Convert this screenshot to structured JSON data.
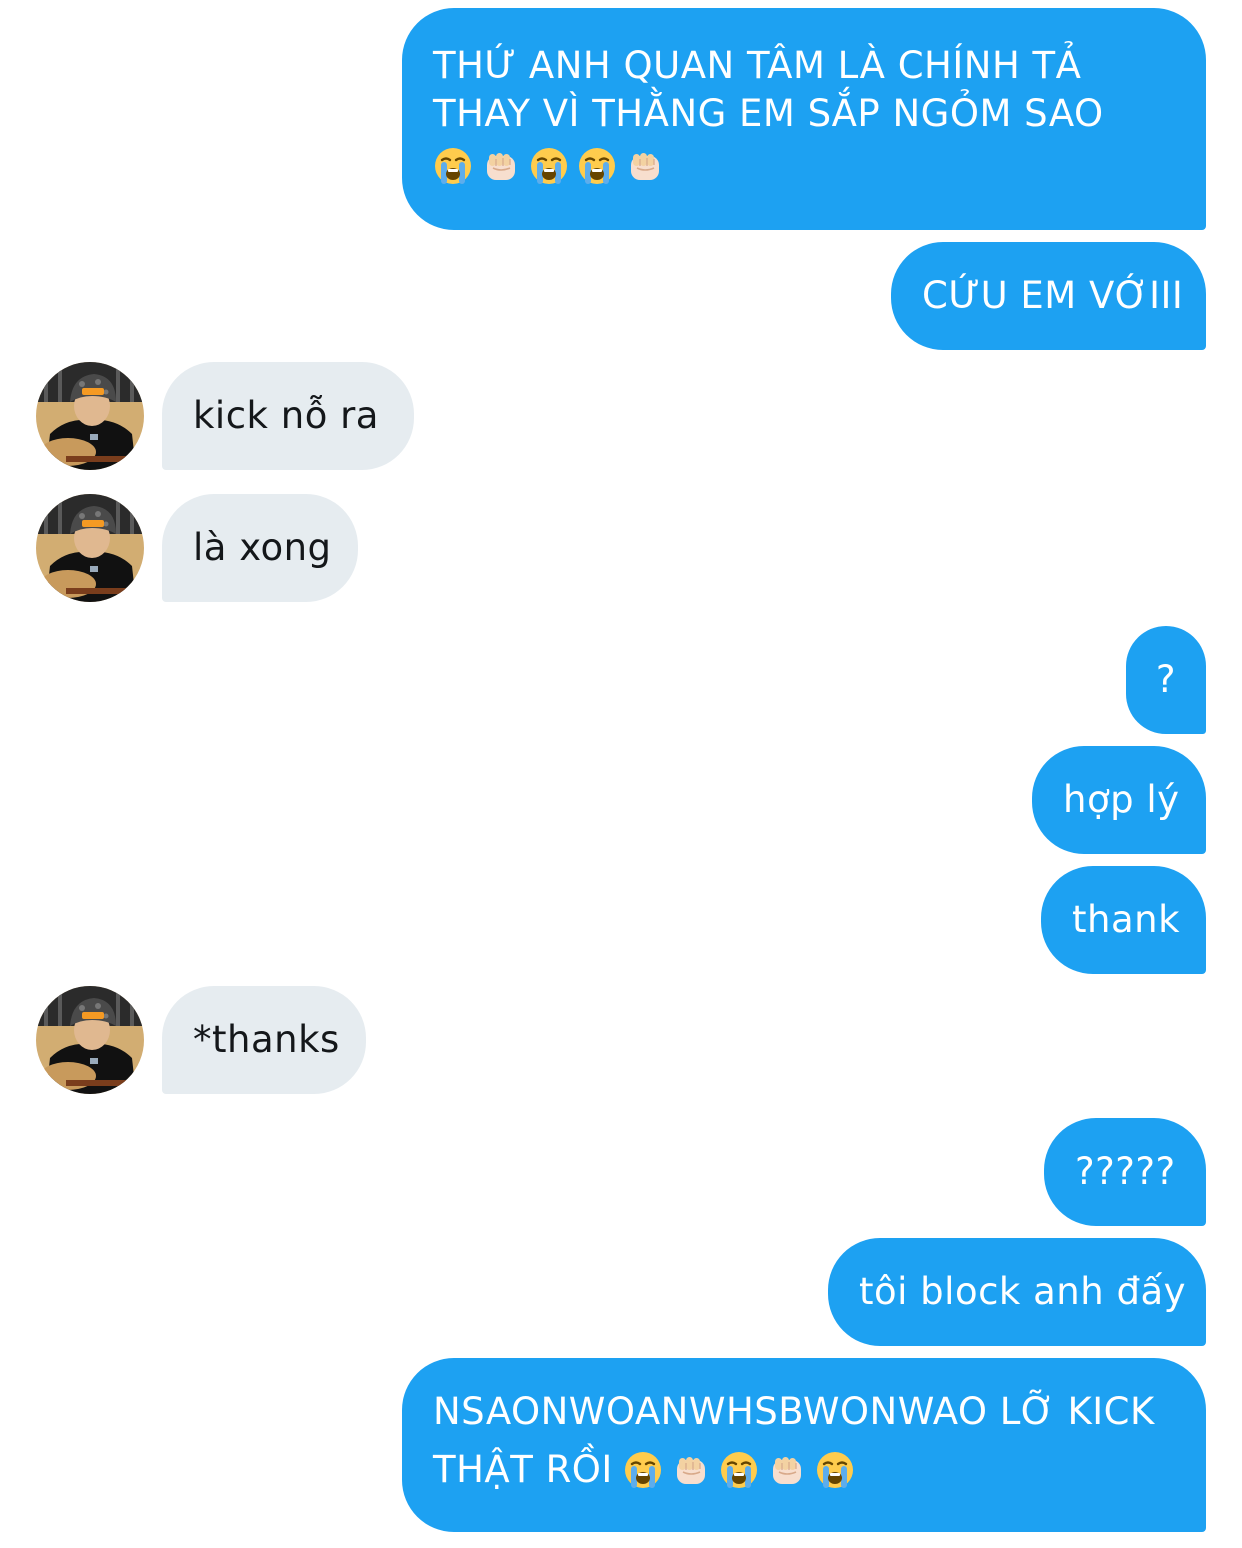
{
  "conversation": {
    "msg1": {
      "lines": [
        "THỨ ANH QUAN TÂM LÀ CHÍNH TẢ",
        "THAY VÌ THẰNG EM SẮP NGỎM SAO"
      ],
      "emojis": [
        "loudly-crying-face",
        "oncoming-fist",
        "loudly-crying-face",
        "loudly-crying-face",
        "oncoming-fist"
      ]
    },
    "msg2": {
      "text": "CỨU EM VỚIII"
    },
    "msg3": {
      "text": "kick nỗ ra"
    },
    "msg4": {
      "text": "là xong"
    },
    "msg5": {
      "text": "?"
    },
    "msg6": {
      "text": "hợp lý"
    },
    "msg7": {
      "text": "thank"
    },
    "msg8": {
      "text": "*thanks"
    },
    "msg9": {
      "text": "?????"
    },
    "msg10": {
      "text": "tôi block anh đấy"
    },
    "msg11": {
      "lines": [
        "NSAONWOANWHSBWONWAO LỠ KICK",
        "THẬT RỒI"
      ],
      "emojis": [
        "loudly-crying-face",
        "oncoming-fist",
        "loudly-crying-face",
        "oncoming-fist",
        "loudly-crying-face"
      ]
    }
  },
  "colors": {
    "sent_bubble": "#1da1f2",
    "received_bubble": "#e6ecf0",
    "sent_text": "#ffffff",
    "received_text": "#14171a"
  },
  "icons": {
    "avatar": "contact-avatar-photo"
  }
}
